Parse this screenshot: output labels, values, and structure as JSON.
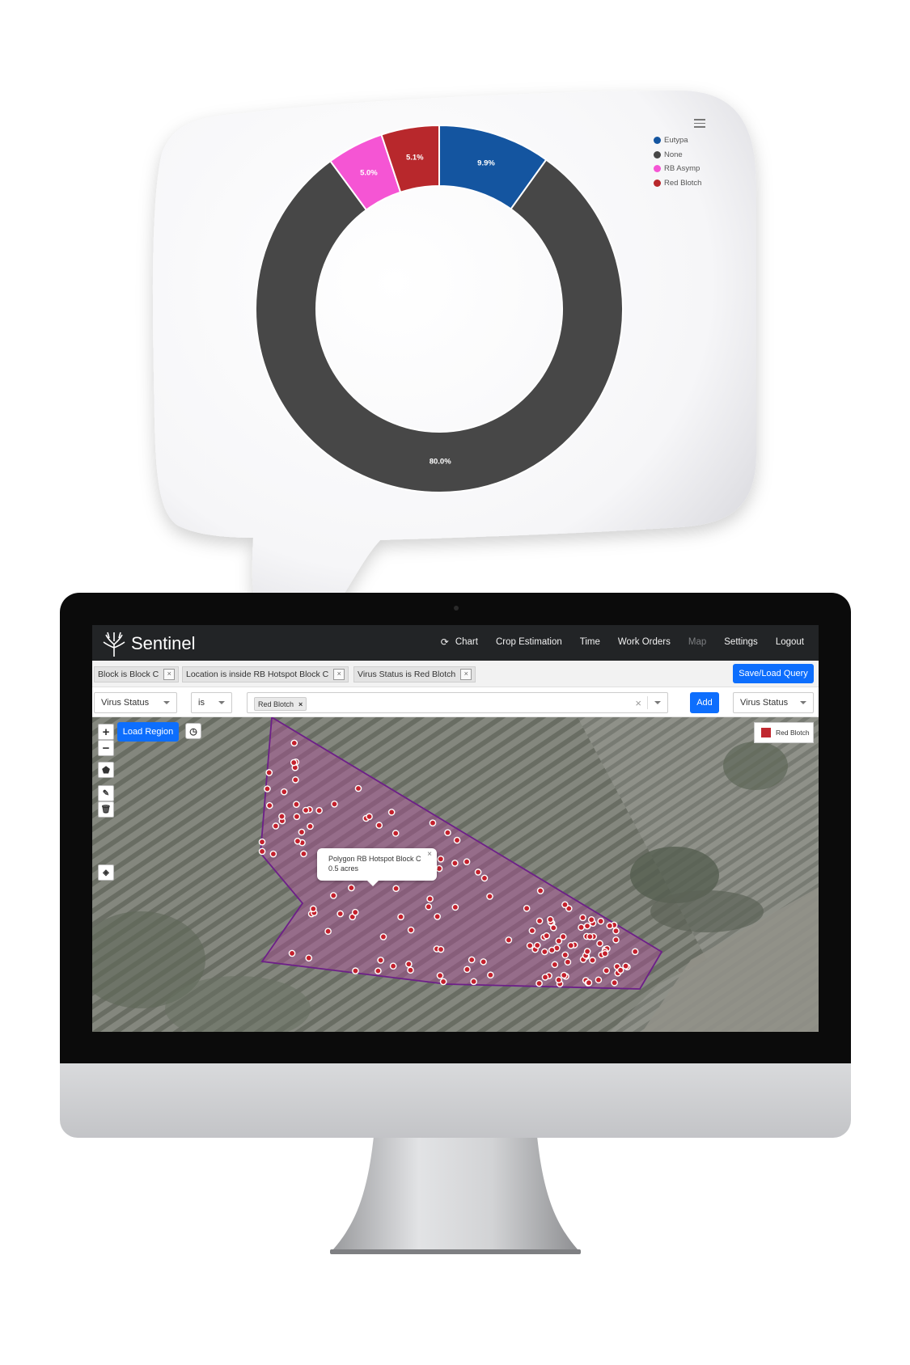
{
  "chart_data": {
    "type": "pie",
    "labels": [
      "Eutypa",
      "None",
      "RB Asymp",
      "Red Blotch"
    ],
    "values": [
      9.9,
      80.0,
      5.0,
      5.1
    ],
    "value_labels": [
      "9.9%",
      "80.0%",
      "5.0%",
      "5.1%"
    ],
    "colors": [
      "#1455a0",
      "#474747",
      "#f555d4",
      "#b8282c"
    ],
    "style": "donut",
    "legend_position": "top-right"
  },
  "app": {
    "brand": "Sentinel",
    "nav": {
      "chart": "Chart",
      "crop_estimation": "Crop Estimation",
      "time": "Time",
      "work_orders": "Work Orders",
      "map": "Map",
      "settings": "Settings",
      "logout": "Logout"
    },
    "filters": [
      {
        "label": "Block is Block C"
      },
      {
        "label": "Location is inside RB Hotspot Block C"
      },
      {
        "label": "Virus Status is Red Blotch"
      }
    ],
    "close_glyph": "×",
    "save_load_label": "Save/Load Query",
    "query": {
      "field": "Virus Status",
      "operator": "is",
      "value_tag": "Red Blotch",
      "tag_remove": "×",
      "clear_glyph": "×",
      "add_label": "Add",
      "group_by": "Virus Status"
    },
    "map": {
      "zoom_in": "+",
      "zoom_out": "−",
      "load_region": "Load Region",
      "legend_label": "Red Blotch",
      "legend_color": "#c0282f",
      "polygon_color": "#7b2d8e",
      "popup_title": "Polygon RB Hotspot Block C",
      "popup_area": "0.5 acres",
      "popup_close": "×"
    }
  }
}
